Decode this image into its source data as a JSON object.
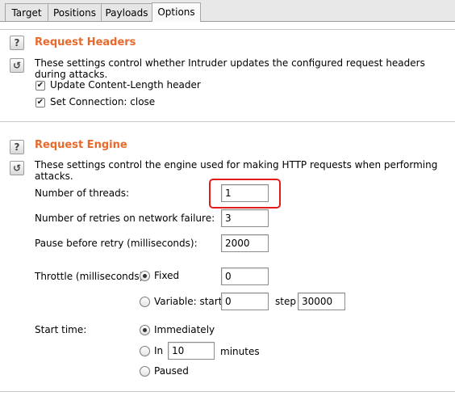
{
  "tabs": [
    {
      "label": "Target"
    },
    {
      "label": "Positions"
    },
    {
      "label": "Payloads"
    },
    {
      "label": "Options"
    }
  ],
  "active_tab": "Options",
  "request_headers": {
    "title": "Request Headers",
    "description": "These settings control whether Intruder updates the configured request headers during attacks.",
    "help_icon": "?",
    "reset_icon": "↺",
    "options": [
      {
        "label": "Update Content-Length header",
        "checked": true
      },
      {
        "label": "Set Connection: close",
        "checked": true
      }
    ]
  },
  "request_engine": {
    "title": "Request Engine",
    "description": "These settings control the engine used for making HTTP requests when performing attacks.",
    "help_icon": "?",
    "reset_icon": "↺",
    "threads": {
      "label": "Number of threads:",
      "value": "1"
    },
    "retries": {
      "label": "Number of retries on network failure:",
      "value": "3"
    },
    "pause": {
      "label": "Pause before retry (milliseconds):",
      "value": "2000"
    },
    "throttle": {
      "label": "Throttle (milliseconds):",
      "fixed_label": "Fixed",
      "fixed_value": "0",
      "variable_label": "Variable:  start",
      "variable_start": "0",
      "step_label": "step",
      "variable_step": "30000",
      "selected": "Fixed"
    },
    "start_time": {
      "label": "Start time:",
      "immediately_label": "Immediately",
      "in_label": "In",
      "in_value": "10",
      "minutes_label": "minutes",
      "paused_label": "Paused",
      "selected": "Immediately"
    }
  },
  "colors": {
    "section_title": "#e8692c",
    "highlight": "#e21b1b"
  }
}
